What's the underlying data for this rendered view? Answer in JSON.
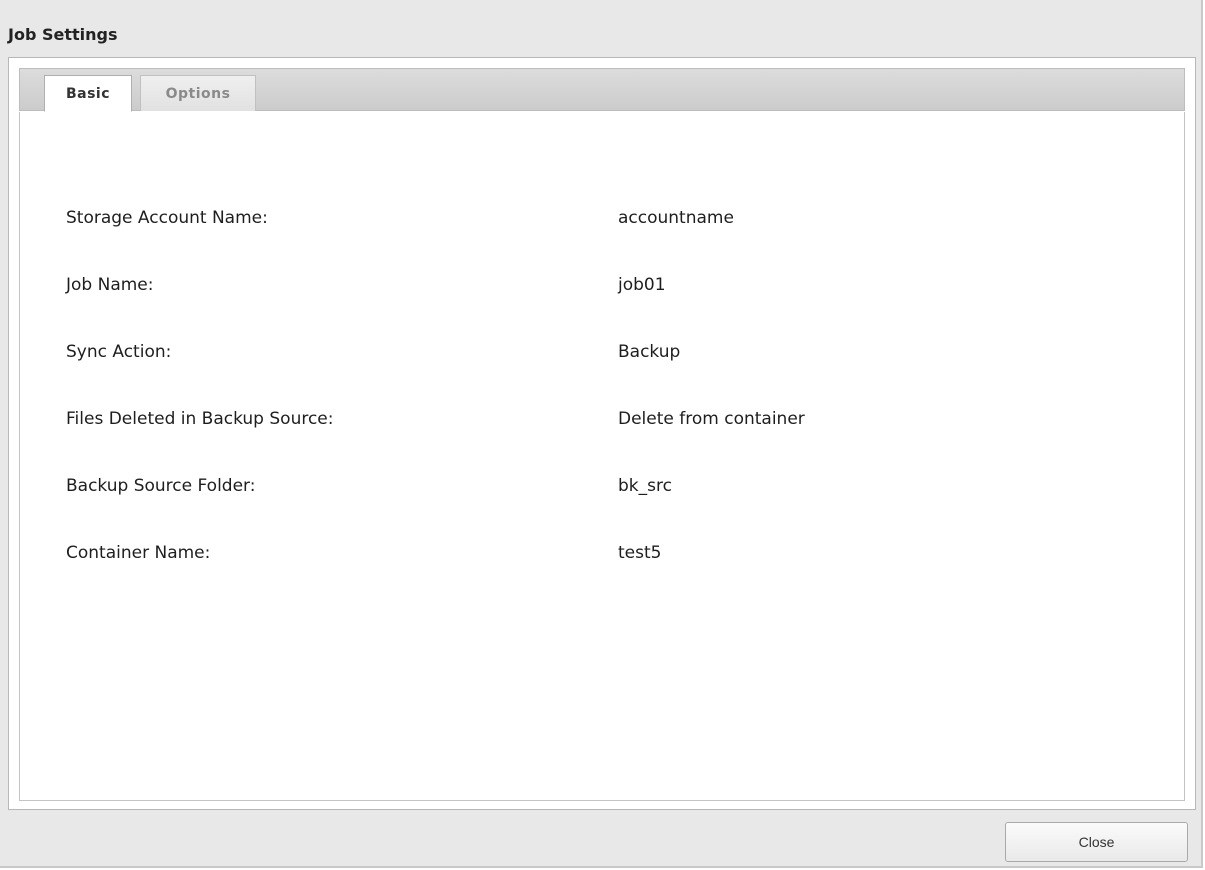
{
  "dialog": {
    "title": "Job Settings"
  },
  "tabs": [
    {
      "label": "Basic",
      "active": true
    },
    {
      "label": "Options",
      "active": false
    }
  ],
  "fields": [
    {
      "label": "Storage Account Name:",
      "value": "accountname"
    },
    {
      "label": "Job Name:",
      "value": "job01"
    },
    {
      "label": "Sync Action:",
      "value": "Backup"
    },
    {
      "label": "Files Deleted in Backup Source:",
      "value": "Delete from container"
    },
    {
      "label": "Backup Source Folder:",
      "value": "bk_src"
    },
    {
      "label": "Container Name:",
      "value": "test5"
    }
  ],
  "footer": {
    "close_label": "Close"
  }
}
